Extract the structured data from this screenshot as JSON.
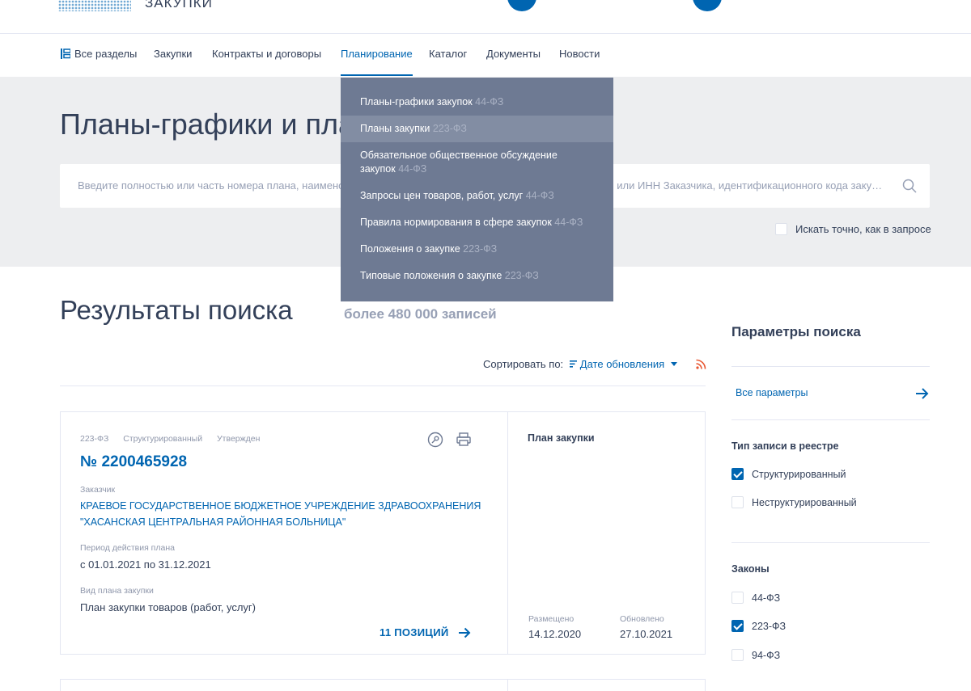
{
  "header": {
    "logo_text": "ЗАКУПКИ"
  },
  "nav": {
    "items": [
      {
        "label": "Все разделы"
      },
      {
        "label": "Закупки"
      },
      {
        "label": "Контракты и договоры"
      },
      {
        "label": "Планирование"
      },
      {
        "label": "Каталог"
      },
      {
        "label": "Документы"
      },
      {
        "label": "Новости"
      }
    ],
    "active": "Планирование"
  },
  "search": {
    "page_title": "Планы-графики и пла",
    "placeholder_left": "Введите полностью или часть номера плана, наименов",
    "placeholder_right": "или ИНН Заказчика, идентификационного кода закуп…",
    "exact_label": "Искать точно, как в запросе"
  },
  "dropdown": {
    "items": [
      {
        "label": "Планы-графики закупок",
        "law": "44-ФЗ"
      },
      {
        "label": "Планы закупки",
        "law": "223-ФЗ"
      },
      {
        "label": "Обязательное общественное обсуждение закупок",
        "law": "44-ФЗ"
      },
      {
        "label": "Запросы цен товаров, работ, услуг",
        "law": "44-ФЗ"
      },
      {
        "label": "Правила нормирования в сфере закупок",
        "law": "44-ФЗ"
      },
      {
        "label": "Положения о закупке",
        "law": "223-ФЗ"
      },
      {
        "label": "Типовые положения о закупке",
        "law": "223-ФЗ"
      }
    ]
  },
  "results": {
    "title": "Результаты поиска",
    "count": "более 480 000 записей",
    "sort_label": "Сортировать по:",
    "sort_value": "Дате обновления"
  },
  "card": {
    "tags": [
      "223-ФЗ",
      "Структурированный",
      "Утвержден"
    ],
    "number": "№ 2200465928",
    "customer_label": "Заказчик",
    "customer_line1": "КРАЕВОЕ ГОСУДАРСТВЕННОЕ БЮДЖЕТНОЕ УЧРЕЖДЕНИЕ ЗДРАВООХРАНЕНИЯ",
    "customer_line2": "\"ХАСАНСКАЯ ЦЕНТРАЛЬНАЯ РАЙОННАЯ БОЛЬНИЦА\"",
    "period_label": "Период действия плана",
    "period_value": "с 01.01.2021 по 31.12.2021",
    "kind_label": "Вид плана закупки",
    "kind_value": "План закупки товаров (работ, услуг)",
    "positions": "11 ПОЗИЦИЙ",
    "plan_type": "План закупки",
    "placed_label": "Размещено",
    "placed_value": "14.12.2020",
    "updated_label": "Обновлено",
    "updated_value": "27.10.2021"
  },
  "sidebar": {
    "title": "Параметры поиска",
    "all_params": "Все параметры",
    "record_type_heading": "Тип записи в реестре",
    "record_types": [
      {
        "label": "Структурированный",
        "checked": true
      },
      {
        "label": "Неструктурированный",
        "checked": false
      }
    ],
    "laws_heading": "Законы",
    "laws": [
      {
        "label": "44-ФЗ",
        "checked": false
      },
      {
        "label": "223-ФЗ",
        "checked": true
      },
      {
        "label": "94-ФЗ",
        "checked": false
      }
    ]
  },
  "colors": {
    "brand": "#0065b1",
    "text": "#334059",
    "muted": "#8f97ab",
    "dropdown_bg": "#6e7a93",
    "band_bg": "#edeef0"
  }
}
